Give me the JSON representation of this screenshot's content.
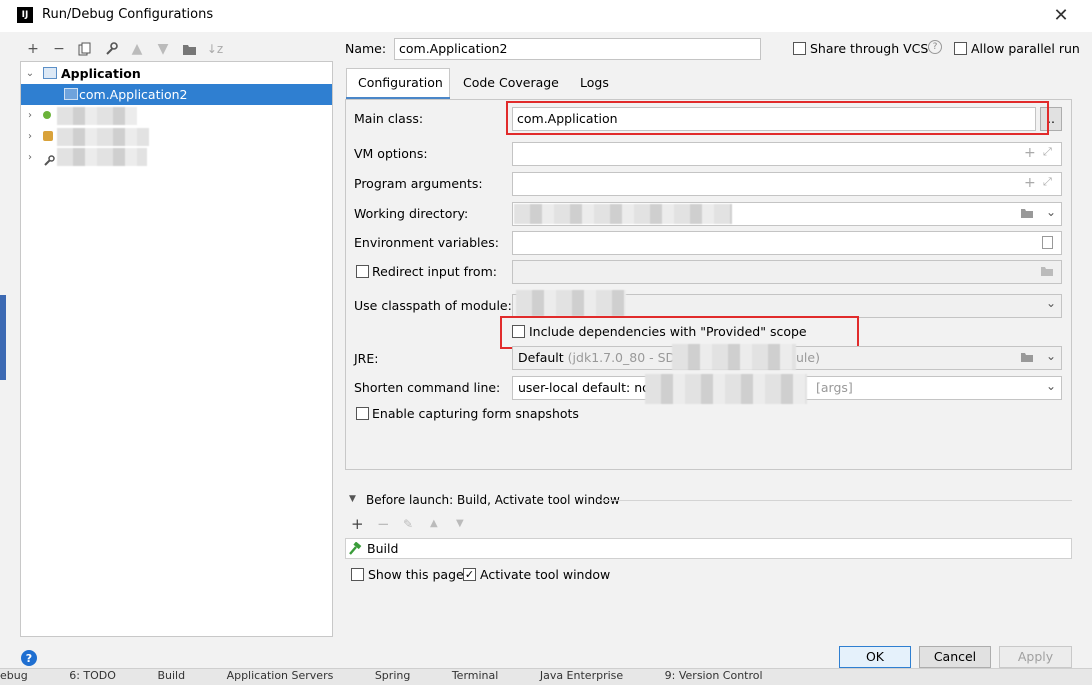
{
  "window": {
    "title": "Run/Debug Configurations",
    "app_icon": "IJ"
  },
  "tree": {
    "group_label": "Application",
    "selected_item": "com.Application2"
  },
  "form": {
    "name_label": "Name:",
    "name_value": "com.Application2",
    "share_vcs_label": "Share through VCS",
    "allow_parallel_label": "Allow parallel run",
    "tabs": [
      "Configuration",
      "Code Coverage",
      "Logs"
    ],
    "main_class_label": "Main class:",
    "main_class_value": "com.Application",
    "vm_options_label": "VM options:",
    "program_args_label": "Program arguments:",
    "working_dir_label": "Working directory:",
    "env_vars_label": "Environment variables:",
    "redirect_input_label": "Redirect input from:",
    "classpath_label": "Use classpath of module:",
    "include_deps_label": "Include dependencies with \"Provided\" scope",
    "jre_label": "JRE:",
    "jre_value_prefix": "Default",
    "jre_value_detail": "(jdk1.7.0_80 - SDK",
    "jre_value_tail": "ule)",
    "shorten_label": "Shorten command line:",
    "shorten_value": "user-local default: non",
    "shorten_tail": "[args]",
    "capture_snapshots_label": "Enable capturing form snapshots"
  },
  "before_launch": {
    "header": "Before launch: Build, Activate tool window",
    "item": "Build",
    "show_page_label": "Show this page",
    "activate_label": "Activate tool window"
  },
  "buttons": {
    "ok": "OK",
    "cancel": "Cancel",
    "apply": "Apply"
  },
  "background": {
    "bottom_tabs": [
      "ebug",
      "6: TODO",
      "Build",
      "Application Servers",
      "Spring",
      "Terminal",
      "Java Enterprise",
      "9: Version Control"
    ]
  },
  "colors": {
    "selection": "#2f7fd1",
    "highlight_box": "#e12b2b",
    "help_icon": "#1f6fd1"
  }
}
